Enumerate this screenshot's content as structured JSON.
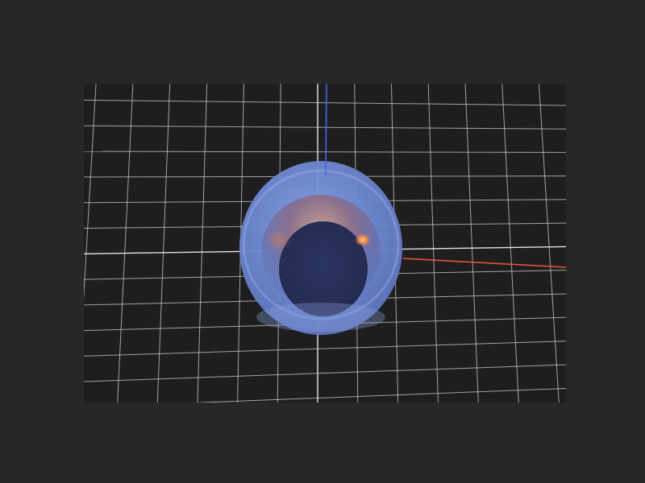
{
  "app": {
    "background_color": "#272727"
  },
  "viewport": {
    "background_color": "#1e1e1e",
    "interaction": "orbit-pan-zoom"
  },
  "scene": {
    "grid": {
      "visible": true,
      "line_color": "#cfcfcf",
      "center_line_color": "#eeeeee"
    },
    "axes": {
      "x": {
        "visible": true,
        "color": "#e0553a"
      },
      "z": {
        "visible": true,
        "color": "#4d63e8"
      }
    },
    "object": {
      "shape": "cup-shaped mesh (open shell)",
      "outer_color": "#6f89d2",
      "inner_color": "#141b3d",
      "highlight_color": "#f08a4b",
      "opacity": "semi-transparent"
    }
  }
}
